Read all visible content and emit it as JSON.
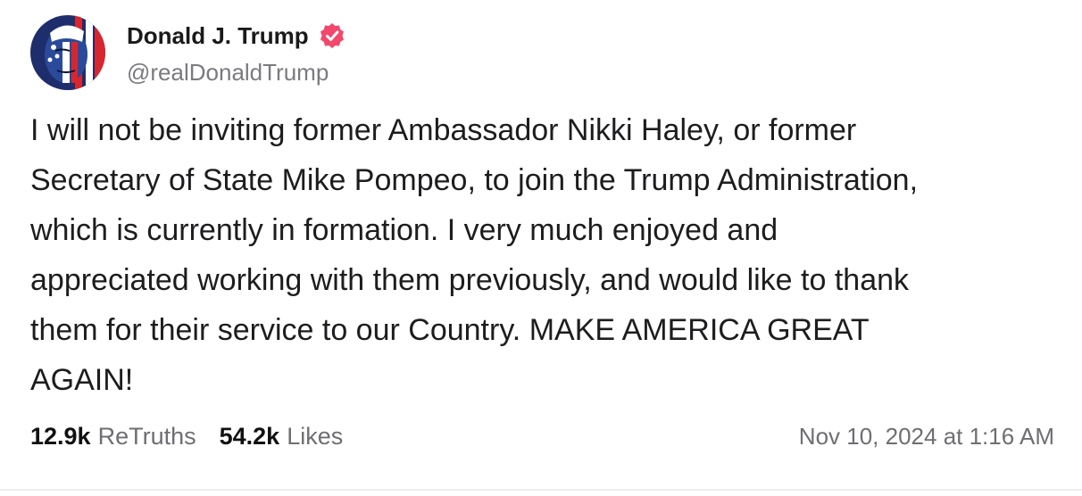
{
  "author": {
    "display_name": "Donald J. Trump",
    "handle": "@realDonaldTrump",
    "verified": true,
    "avatar_icon": "profile-avatar-flag-portrait",
    "verified_icon": "verified-badge-icon",
    "verified_color": "#f2486b"
  },
  "post": {
    "text": "I will not be inviting former Ambassador Nikki Haley, or former Secretary of State Mike Pompeo, to join the Trump Administration, which is currently in formation. I very much enjoyed and appreciated working with them previously, and would like to thank them for their service to our Country. MAKE AMERICA GREAT AGAIN!",
    "lines": [
      "I will not be inviting former Ambassador Nikki Haley, or former",
      "Secretary of State Mike Pompeo, to join the Trump Administration,",
      "which is currently in formation. I very much enjoyed and",
      "appreciated working with them previously, and would like to thank",
      "them for their service to our Country. MAKE AMERICA GREAT",
      "AGAIN!"
    ]
  },
  "stats": {
    "retruths_count": "12.9k",
    "retruths_label": "ReTruths",
    "likes_count": "54.2k",
    "likes_label": "Likes"
  },
  "timestamp": "Nov 10, 2024 at 1:16 AM"
}
